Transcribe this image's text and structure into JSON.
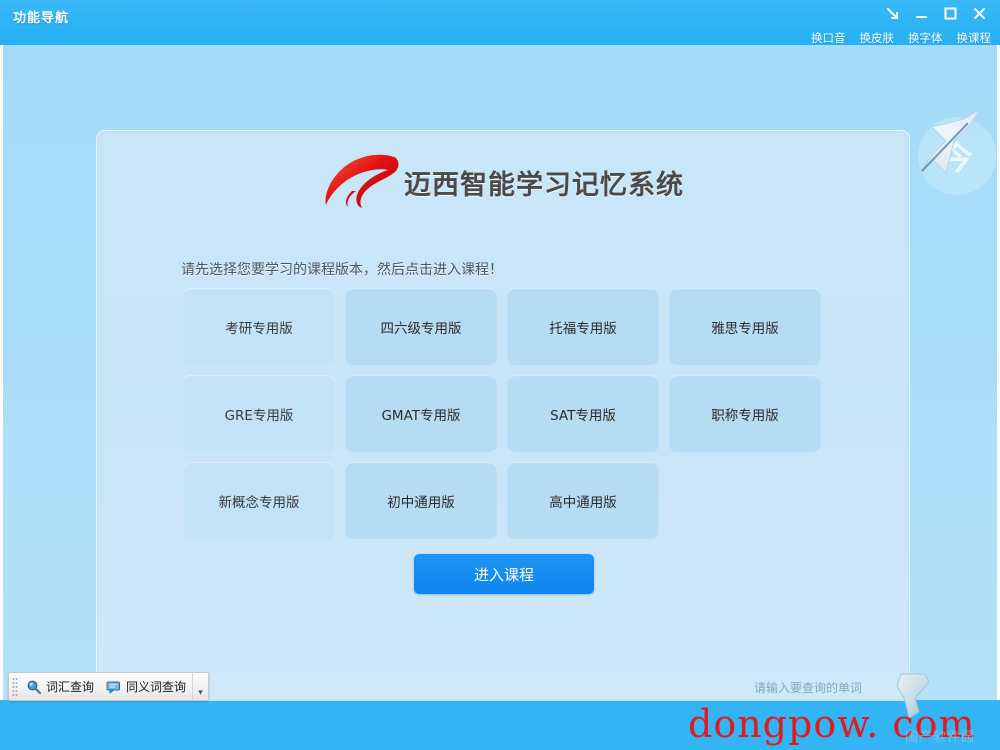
{
  "window": {
    "title": "功能导航",
    "controls": [
      {
        "name": "minimize-to-tray",
        "glyph": "↘"
      },
      {
        "name": "minimize",
        "glyph": "—"
      },
      {
        "name": "maximize",
        "glyph": "☐"
      },
      {
        "name": "close",
        "glyph": "✕"
      }
    ]
  },
  "menu": {
    "items": [
      {
        "label": "换口音"
      },
      {
        "label": "换皮肤"
      },
      {
        "label": "换字体"
      },
      {
        "label": "换课程"
      }
    ]
  },
  "branding": {
    "logo_text": "迈西智能学习记忆系统",
    "logo_icon": "red-swoosh-logo-icon",
    "accent_red": "#d81515",
    "logo_text_color": "#4a4a4a"
  },
  "panel": {
    "instruction": "请先选择您要学习的课程版本，然后点击进入课程！",
    "courses": [
      [
        {
          "label": "考研专用版",
          "selected": true
        },
        {
          "label": "四六级专用版",
          "selected": false
        },
        {
          "label": "托福专用版",
          "selected": false
        },
        {
          "label": "雅思专用版",
          "selected": false
        }
      ],
      [
        {
          "label": "GRE专用版",
          "selected": true
        },
        {
          "label": "GMAT专用版",
          "selected": false
        },
        {
          "label": "SAT专用版",
          "selected": false
        },
        {
          "label": "职称专用版",
          "selected": false
        }
      ],
      [
        {
          "label": "新概念专用版",
          "selected": true
        },
        {
          "label": "初中通用版",
          "selected": false
        },
        {
          "label": "高中通用版",
          "selected": false
        }
      ]
    ],
    "enter_button": "进入课程"
  },
  "watermarks": {
    "circle_char": "今",
    "site": "dongpow. com",
    "site_color": "#e01b1b",
    "cn_text": "国产软件园"
  },
  "toolbar": {
    "items": [
      {
        "label": "词汇查询",
        "icon": "magnifier-icon"
      },
      {
        "label": "同义词查询",
        "icon": "speech-bubble-icon"
      }
    ],
    "overflow_glyph": "▾"
  },
  "search": {
    "placeholder": "请输入要查询的单词",
    "value": ""
  },
  "colors": {
    "header_blue": "#33b5f5",
    "body_blue": "#a9def8",
    "panel_blue": "#c7e5f8",
    "tile_blue": "#b6dcf3",
    "tile_selected_blue": "#c2e2f6",
    "button_blue": "#0d86ef"
  }
}
